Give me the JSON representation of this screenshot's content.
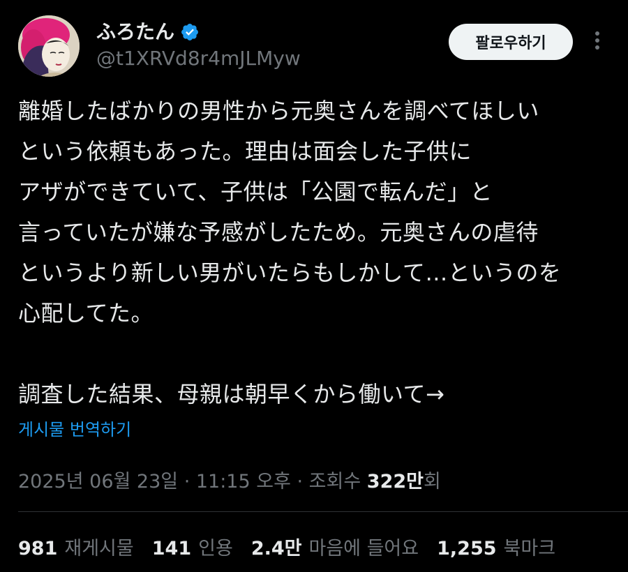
{
  "author": {
    "display_name": "ふろたん",
    "handle": "@t1XRVd8r4mJLMyw",
    "verified": true,
    "avatar_icon": "ukiyoe-portrait-avatar"
  },
  "actions": {
    "follow_label": "팔로우하기",
    "more_icon": "more-vertical-icon"
  },
  "post": {
    "lines": [
      "離婚したばかりの男性から元奥さんを調べてほしい",
      "という依頼もあった。理由は面会した子供に",
      "アザができていて、子供は「公園で転んだ」と",
      "言っていたが嫌な予感がしたため。元奥さんの虐待",
      "というより新しい男がいたらもしかして…というのを",
      "心配してた。",
      "",
      "調査した結果、母親は朝早くから働いて→"
    ],
    "translate_label": "게시물 번역하기"
  },
  "meta": {
    "timestamp": "2025년 06월 23일 · 11:15 오후 · 조회수 ",
    "views_value": "322만",
    "views_suffix": "회"
  },
  "stats": {
    "reposts_count": "981",
    "reposts_label": "재게시물",
    "quotes_count": "141",
    "quotes_label": "인용",
    "likes_count": "2.4만",
    "likes_label": "마음에 들어요",
    "bookmarks_count": "1,255",
    "bookmarks_label": "북마크"
  },
  "colors": {
    "background": "#000000",
    "text_primary": "#e7e9ea",
    "text_secondary": "#71767b",
    "link": "#1d9bf0",
    "verified_badge": "#1d9bf0",
    "follow_button_bg": "#eff3f4"
  }
}
